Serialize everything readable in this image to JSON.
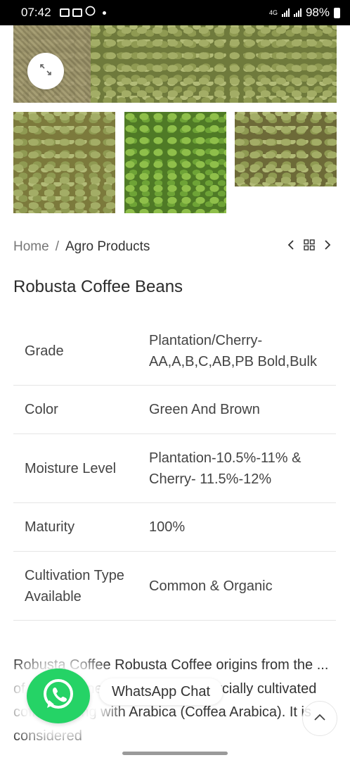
{
  "status_bar": {
    "time": "07:42",
    "network": "4G",
    "battery": "98%"
  },
  "breadcrumb": {
    "home": "Home",
    "separator": "/",
    "current": "Agro Products"
  },
  "product": {
    "title": "Robusta Coffee Beans"
  },
  "specs": [
    {
      "label": "Grade",
      "value": "Plantation/Cherry- AA,A,B,C,AB,PB Bold,Bulk"
    },
    {
      "label": "Color",
      "value": "Green And Brown"
    },
    {
      "label": "Moisture Level",
      "value": "Plantation-10.5%-11% & Cherry- 11.5%-12%"
    },
    {
      "label": "Maturity",
      "value": "100%"
    },
    {
      "label": "Cultivation Type Available",
      "value": "Common & Organic"
    }
  ],
  "description": "Robusta Coffee Robusta Coffee origins from the ... of ... plant one of the two commercially cultivated coffees along with Arabica (Coffea Arabica). It is considered",
  "whatsapp": {
    "label": "WhatsApp Chat"
  },
  "icons": {
    "zoom": "expand-icon",
    "prev": "chevron-left-icon",
    "grid": "grid-icon",
    "next": "chevron-right-icon",
    "whatsapp": "whatsapp-icon",
    "scroll_top": "chevron-up-icon"
  },
  "colors": {
    "whatsapp_green": "#25d366",
    "status_bar": "#000000"
  }
}
